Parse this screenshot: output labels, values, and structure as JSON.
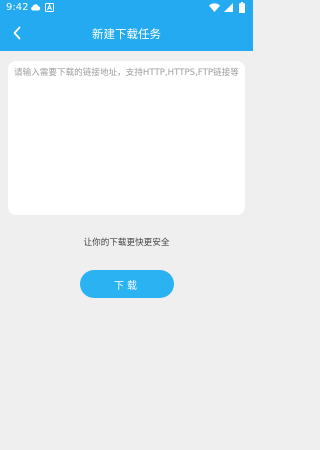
{
  "status_bar": {
    "time": "9:42",
    "icons": [
      "cloud-icon",
      "notification-a-icon",
      "wifi-icon",
      "signal-icon",
      "battery-icon"
    ]
  },
  "header": {
    "title": "新建下载任务",
    "back_icon": "chevron-left-icon"
  },
  "url_input": {
    "value": "",
    "placeholder": "请输入需要下载的链接地址，支持HTTP,HTTPS,FTP链接等"
  },
  "tagline": "让你的下载更快更安全",
  "download_button": {
    "label": "下载"
  },
  "colors": {
    "brand": "#24aaf0",
    "button": "#2ab2f3",
    "background": "#efefef",
    "card": "#ffffff",
    "placeholder": "#9e9e9e"
  }
}
